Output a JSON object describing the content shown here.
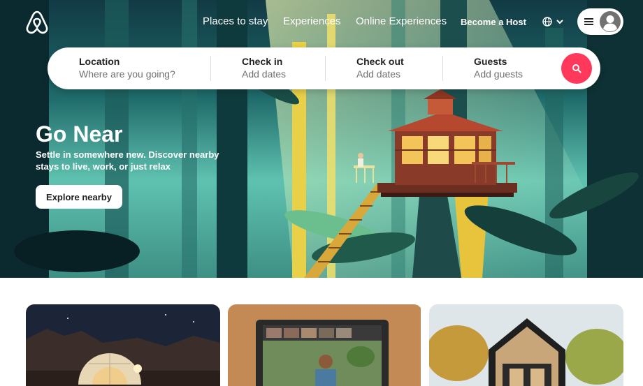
{
  "nav": {
    "places_to_stay": "Places to stay",
    "experiences": "Experiences",
    "online_experiences": "Online Experiences",
    "become_host": "Become a Host"
  },
  "search": {
    "location_title": "Location",
    "location_placeholder": "Where are you going?",
    "checkin_title": "Check in",
    "checkin_placeholder": "Add dates",
    "checkout_title": "Check out",
    "checkout_placeholder": "Add dates",
    "guests_title": "Guests",
    "guests_placeholder": "Add guests"
  },
  "hero": {
    "title": "Go Near",
    "subtitle": "Settle in somewhere new. Discover nearby stays to live, work, or just relax",
    "cta": "Explore nearby"
  },
  "colors": {
    "brand": "#ff385c",
    "text": "#222222",
    "muted": "#717171"
  },
  "icons": [
    "airbnb-logo",
    "globe-icon",
    "chevron-down-icon",
    "menu-icon",
    "user-avatar-icon",
    "search-icon"
  ]
}
